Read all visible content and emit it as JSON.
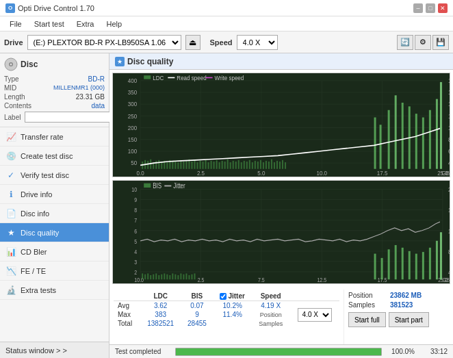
{
  "titleBar": {
    "title": "Opti Drive Control 1.70",
    "minimize": "–",
    "maximize": "□",
    "close": "✕"
  },
  "menuBar": {
    "items": [
      "File",
      "Start test",
      "Extra",
      "Help"
    ]
  },
  "driveBar": {
    "label": "Drive",
    "driveValue": "(E:)  PLEXTOR BD-R  PX-LB950SA 1.06",
    "speedLabel": "Speed",
    "speedValue": "4.0 X"
  },
  "disc": {
    "title": "Disc",
    "fields": [
      {
        "label": "Type",
        "value": "BD-R",
        "blue": true
      },
      {
        "label": "MID",
        "value": "MILLENMR1 (000)",
        "blue": true
      },
      {
        "label": "Length",
        "value": "23.31 GB",
        "blue": false
      },
      {
        "label": "Contents",
        "value": "data",
        "blue": true
      }
    ],
    "labelField": {
      "label": "Label",
      "placeholder": ""
    }
  },
  "navItems": [
    {
      "id": "transfer-rate",
      "label": "Transfer rate",
      "icon": "📈"
    },
    {
      "id": "create-test-disc",
      "label": "Create test disc",
      "icon": "💿"
    },
    {
      "id": "verify-test-disc",
      "label": "Verify test disc",
      "icon": "✓"
    },
    {
      "id": "drive-info",
      "label": "Drive info",
      "icon": "ℹ"
    },
    {
      "id": "disc-info",
      "label": "Disc info",
      "icon": "📄"
    },
    {
      "id": "disc-quality",
      "label": "Disc quality",
      "icon": "★",
      "active": true
    },
    {
      "id": "cd-bler",
      "label": "CD Bler",
      "icon": "📊"
    },
    {
      "id": "fe-te",
      "label": "FE / TE",
      "icon": "📉"
    },
    {
      "id": "extra-tests",
      "label": "Extra tests",
      "icon": "🔬"
    }
  ],
  "statusWindow": {
    "label": "Status window > >"
  },
  "discQuality": {
    "title": "Disc quality",
    "legend": {
      "ldc": {
        "label": "LDC",
        "color": "#3c6e3c"
      },
      "readSpeed": {
        "label": "Read speed",
        "color": "#ffffff"
      },
      "writeSpeed": {
        "label": "Write speed",
        "color": "#cc44cc"
      }
    },
    "legend2": {
      "bis": {
        "label": "BIS",
        "color": "#3c6e3c"
      },
      "jitter": {
        "label": "Jitter",
        "color": "#cccccc"
      }
    }
  },
  "stats": {
    "headers": [
      "LDC",
      "BIS",
      "",
      "Jitter",
      "Speed",
      ""
    ],
    "rows": [
      {
        "label": "Avg",
        "ldc": "3.62",
        "bis": "0.07",
        "jitter": "10.2%",
        "speed": "4.19 X"
      },
      {
        "label": "Max",
        "ldc": "383",
        "bis": "9",
        "jitter": "11.4%",
        "position": "23862 MB"
      },
      {
        "label": "Total",
        "ldc": "1382521",
        "bis": "28455",
        "jitter": "",
        "samples": "381523"
      }
    ],
    "speedSelect": "4.0 X",
    "startFull": "Start full",
    "startPart": "Start part"
  },
  "progressBar": {
    "percent": 100.0,
    "percentText": "100.0%",
    "time": "33:12"
  },
  "statusText": "Test completed"
}
